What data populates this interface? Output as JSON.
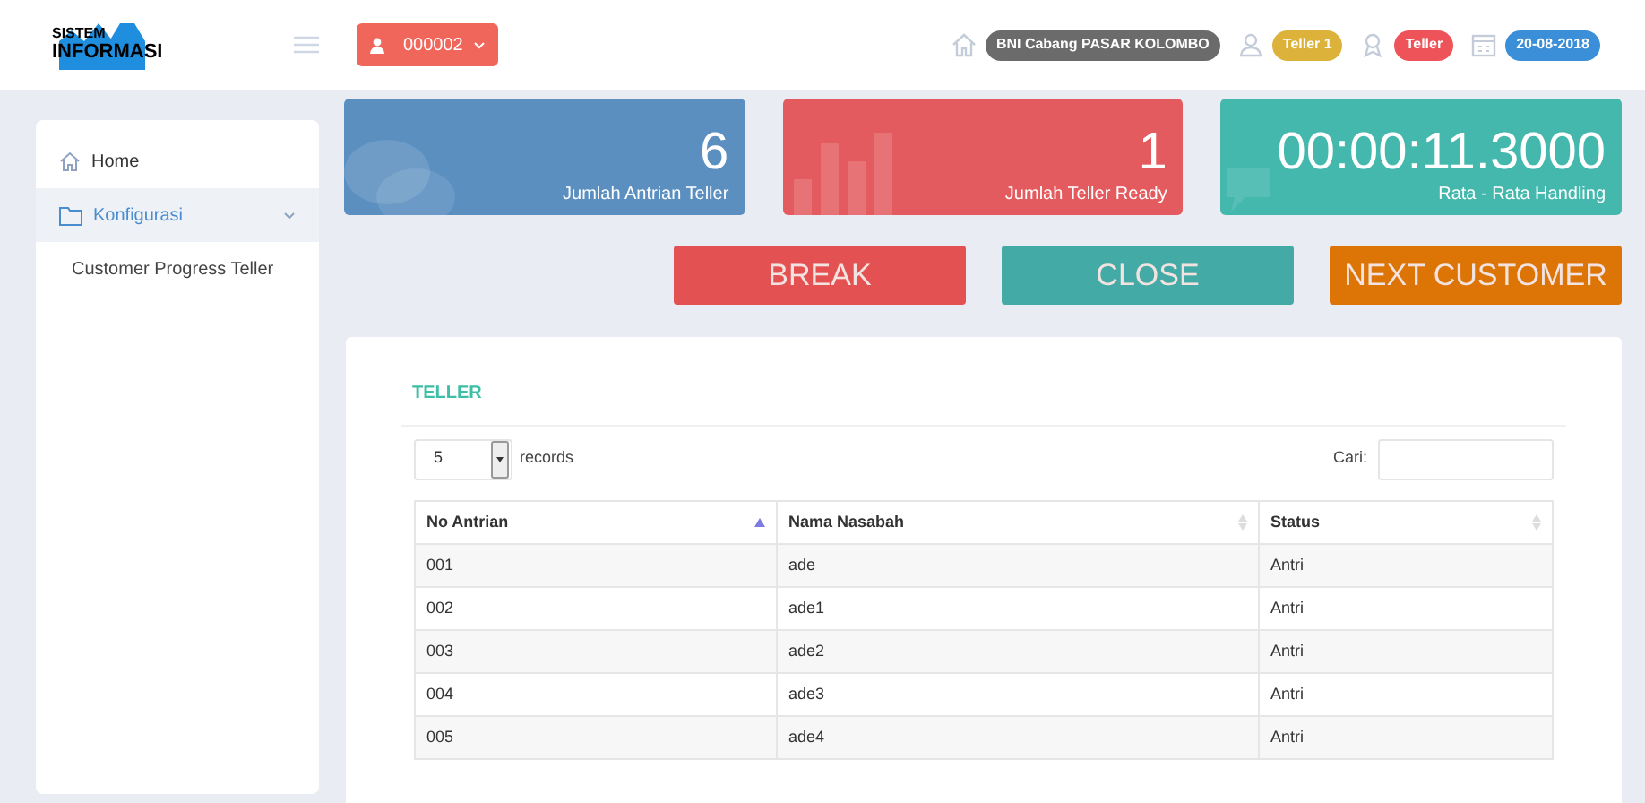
{
  "header": {
    "logo": {
      "line_1": "SISTEM",
      "line_2": "INFORMASI"
    },
    "user_button": "000002",
    "badges": [
      {
        "kind": "branch",
        "text": "BNI Cabang PASAR KOLOMBO",
        "color": "#6b6b6b"
      },
      {
        "kind": "user",
        "text": "Teller 1",
        "color": "#dcb23a"
      },
      {
        "kind": "role",
        "text": "Teller",
        "color": "#ee5359"
      },
      {
        "kind": "date",
        "text": "20-08-2018",
        "color": "#3a8fd8"
      }
    ]
  },
  "sidebar": {
    "items": [
      {
        "kind": "home",
        "label": "Home",
        "selected": false
      },
      {
        "kind": "folder",
        "label": "Konfigurasi",
        "selected": true,
        "expanded": true,
        "children": [
          {
            "label": "Customer Progress Teller"
          }
        ]
      }
    ]
  },
  "stats": [
    {
      "kind": "bubbles",
      "value": "6",
      "label": "Jumlah Antrian Teller",
      "color": "#5b8fc0"
    },
    {
      "kind": "bars",
      "value": "1",
      "label": "Jumlah Teller Ready",
      "color": "#e35b5e"
    },
    {
      "kind": "chat",
      "value": "00:00:11.3000",
      "label": "Rata - Rata Handling",
      "color": "#45b8ad"
    }
  ],
  "actions": [
    {
      "label": "BREAK",
      "color": "#e35152"
    },
    {
      "label": "CLOSE",
      "color": "#43aaa5"
    },
    {
      "label": "NEXT CUSTOMER",
      "color": "#dd7406"
    }
  ],
  "table": {
    "title": "TELLER",
    "page_size": "5",
    "records_label": "records",
    "search_label": "Cari:",
    "columns": [
      {
        "label": "No Antrian",
        "sorted": true
      },
      {
        "label": "Nama Nasabah",
        "sorted": false
      },
      {
        "label": "Status",
        "sorted": false
      }
    ],
    "rows": [
      [
        "001",
        "ade",
        "Antri"
      ],
      [
        "002",
        "ade1",
        "Antri"
      ],
      [
        "003",
        "ade2",
        "Antri"
      ],
      [
        "004",
        "ade3",
        "Antri"
      ],
      [
        "005",
        "ade4",
        "Antri"
      ]
    ]
  }
}
